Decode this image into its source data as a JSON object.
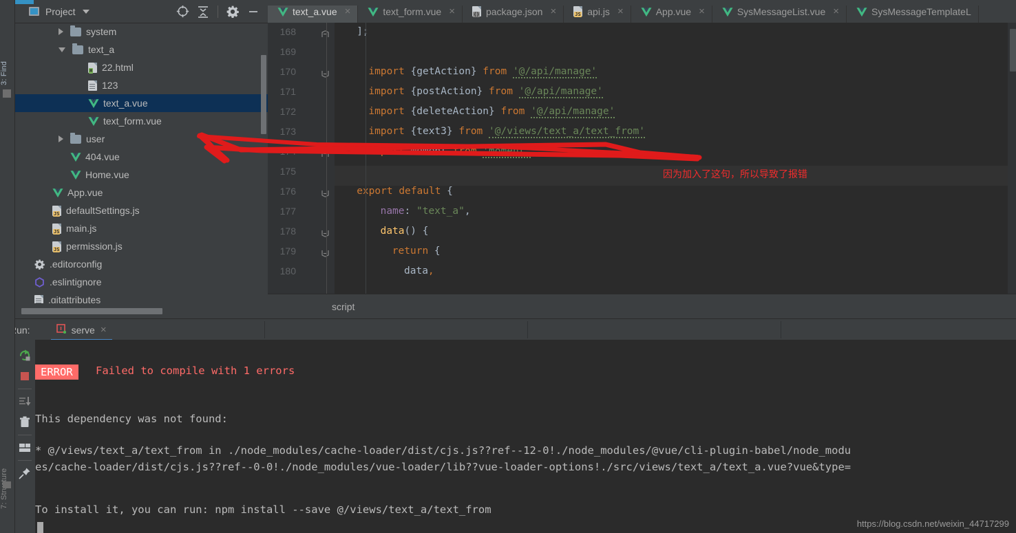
{
  "window": {
    "left_strip_top_label": "3: Find",
    "left_strip_bottom_label": "7: Structure"
  },
  "project_panel": {
    "title": "Project",
    "icons": [
      {
        "name": "locate-icon",
        "glyph": "target"
      },
      {
        "name": "collapse-all-icon",
        "glyph": "collapse"
      },
      {
        "name": "settings-gear-icon",
        "glyph": "gear"
      },
      {
        "name": "hide-icon",
        "glyph": "minus"
      }
    ],
    "tree": [
      {
        "label": "system",
        "icon": "folder",
        "arrow": "closed",
        "indent": 1,
        "selected": false
      },
      {
        "label": "text_a",
        "icon": "folder",
        "arrow": "open",
        "indent": 1,
        "selected": false
      },
      {
        "label": "22.html",
        "icon": "html",
        "arrow": "none",
        "indent": 2,
        "selected": false
      },
      {
        "label": "123",
        "icon": "text",
        "arrow": "none",
        "indent": 2,
        "selected": false
      },
      {
        "label": "text_a.vue",
        "icon": "vue",
        "arrow": "none",
        "indent": 2,
        "selected": true
      },
      {
        "label": "text_form.vue",
        "icon": "vue",
        "arrow": "none",
        "indent": 2,
        "selected": false
      },
      {
        "label": "user",
        "icon": "folder",
        "arrow": "closed",
        "indent": 1,
        "selected": false
      },
      {
        "label": "404.vue",
        "icon": "vue",
        "arrow": "none",
        "indent": 1,
        "selected": false
      },
      {
        "label": "Home.vue",
        "icon": "vue",
        "arrow": "none",
        "indent": 1,
        "selected": false
      },
      {
        "label": "App.vue",
        "icon": "vue",
        "arrow": "none",
        "indent": 0,
        "selected": false
      },
      {
        "label": "defaultSettings.js",
        "icon": "js",
        "arrow": "none",
        "indent": 0,
        "selected": false
      },
      {
        "label": "main.js",
        "icon": "js",
        "arrow": "none",
        "indent": 0,
        "selected": false
      },
      {
        "label": "permission.js",
        "icon": "js",
        "arrow": "none",
        "indent": 0,
        "selected": false
      },
      {
        "label": ".editorconfig",
        "icon": "gear",
        "arrow": "none",
        "indent": -1,
        "selected": false
      },
      {
        "label": ".eslintignore",
        "icon": "eslint",
        "arrow": "none",
        "indent": -1,
        "selected": false
      },
      {
        "label": ".gitattributes",
        "icon": "text",
        "arrow": "none",
        "indent": -1,
        "selected": false
      }
    ]
  },
  "editor": {
    "tabs": [
      {
        "label": "text_a.vue",
        "icon": "vue",
        "active": true,
        "closable": true
      },
      {
        "label": "text_form.vue",
        "icon": "vue",
        "active": false,
        "closable": true
      },
      {
        "label": "package.json",
        "icon": "json",
        "active": false,
        "closable": true
      },
      {
        "label": "api.js",
        "icon": "js",
        "active": false,
        "closable": true
      },
      {
        "label": "App.vue",
        "icon": "vue",
        "active": false,
        "closable": true
      },
      {
        "label": "SysMessageList.vue",
        "icon": "vue",
        "active": false,
        "closable": true
      },
      {
        "label": "SysMessageTemplateL",
        "icon": "vue",
        "active": false,
        "closable": false
      }
    ],
    "close_glyph": "×",
    "lines": [
      {
        "n": "168",
        "fold": "end",
        "text": "];"
      },
      {
        "n": "169",
        "fold": "",
        "text": ""
      },
      {
        "n": "170",
        "fold": "start",
        "text": "import {getAction} from '@/api/manage'"
      },
      {
        "n": "171",
        "fold": "",
        "text": "import {postAction} from '@/api/manage'"
      },
      {
        "n": "172",
        "fold": "",
        "text": "import {deleteAction} from '@/api/manage'"
      },
      {
        "n": "173",
        "fold": "",
        "text": "import {text3} from '@/views/text_a/text_from'"
      },
      {
        "n": "174",
        "fold": "end",
        "text": "import moment from 'moment'"
      },
      {
        "n": "175",
        "fold": "",
        "text": ""
      },
      {
        "n": "176",
        "fold": "start",
        "text": "export default {"
      },
      {
        "n": "177",
        "fold": "",
        "text": "name: \"text_a\","
      },
      {
        "n": "178",
        "fold": "start",
        "text": "data() {"
      },
      {
        "n": "179",
        "fold": "start",
        "text": "return {"
      },
      {
        "n": "180",
        "fold": "",
        "text": "data,"
      }
    ],
    "breadcrumb": "script"
  },
  "annotation": {
    "text": "因为加入了这句，所以导致了报错",
    "color": "#f22c2c"
  },
  "run_panel": {
    "label": "Run:",
    "tab_label": "serve",
    "tab_close_glyph": "×",
    "tools": [
      {
        "name": "rerun-icon",
        "glyph": "rerun"
      },
      {
        "name": "stop-icon",
        "glyph": "stop"
      },
      {
        "name": "scroll-to-end-icon",
        "glyph": "scroll"
      },
      {
        "name": "trash-icon",
        "glyph": "trash"
      },
      {
        "name": "layout-icon",
        "glyph": "layout"
      },
      {
        "name": "pin-icon",
        "glyph": "pin"
      }
    ],
    "console": {
      "error_badge": "ERROR",
      "error_title": "Failed to compile with 1 errors",
      "dependency_header": "This dependency was not found:",
      "dependency_line_1": "* @/views/text_a/text_from in ./node_modules/cache-loader/dist/cjs.js??ref--12-0!./node_modules/@vue/cli-plugin-babel/node_modu",
      "dependency_line_2": "es/cache-loader/dist/cjs.js??ref--0-0!./node_modules/vue-loader/lib??vue-loader-options!./src/views/text_a/text_a.vue?vue&type=",
      "install_hint": "To install it, you can run: npm install --save @/views/text_a/text_from"
    }
  },
  "watermark": "https://blog.csdn.net/weixin_44717299",
  "colors": {
    "panel_bg": "#3c3f41",
    "editor_bg": "#2b2b2b",
    "selection": "#0d3055",
    "accent_blue": "#4a88c7",
    "error_red": "#ff6b68",
    "annotation_red": "#f22c2c",
    "string_green": "#6a8759",
    "keyword_orange": "#cc7832"
  }
}
